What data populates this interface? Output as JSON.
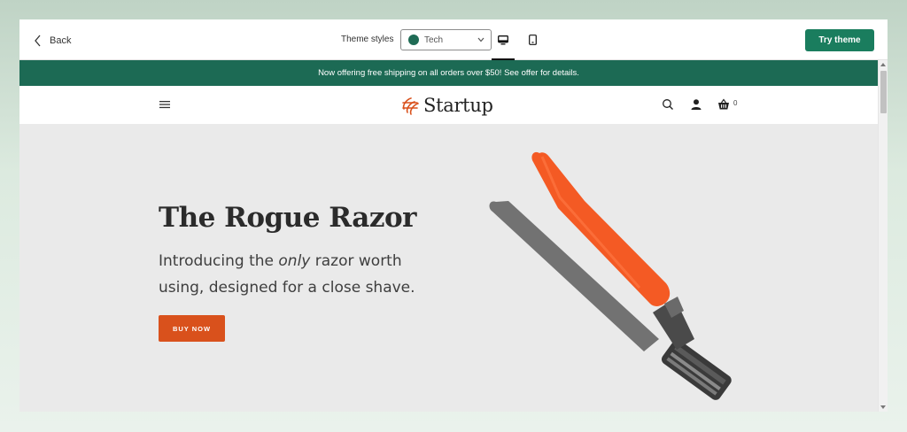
{
  "toolbar": {
    "back_label": "Back",
    "theme_styles_label": "Theme styles",
    "style_select": {
      "value": "Tech",
      "swatch_color": "#1f6b55"
    },
    "view_modes": [
      "desktop-icon",
      "mobile-icon"
    ],
    "try_theme_label": "Try theme",
    "accent_color": "#1a7d5e"
  },
  "store": {
    "announcement": "Now offering free shipping on all orders over $50! See offer for details.",
    "announcement_bg": "#1c6a54",
    "logo_text": "Startup",
    "cart_count": "0",
    "hero": {
      "title": "The Rogue Razor",
      "subtitle_before": "Introducing the ",
      "subtitle_emphasis": "only",
      "subtitle_after": " razor worth using, designed for a close shave.",
      "button_label": "BUY NOW",
      "button_color": "#d9511c",
      "product_image": "orange-razor"
    }
  }
}
